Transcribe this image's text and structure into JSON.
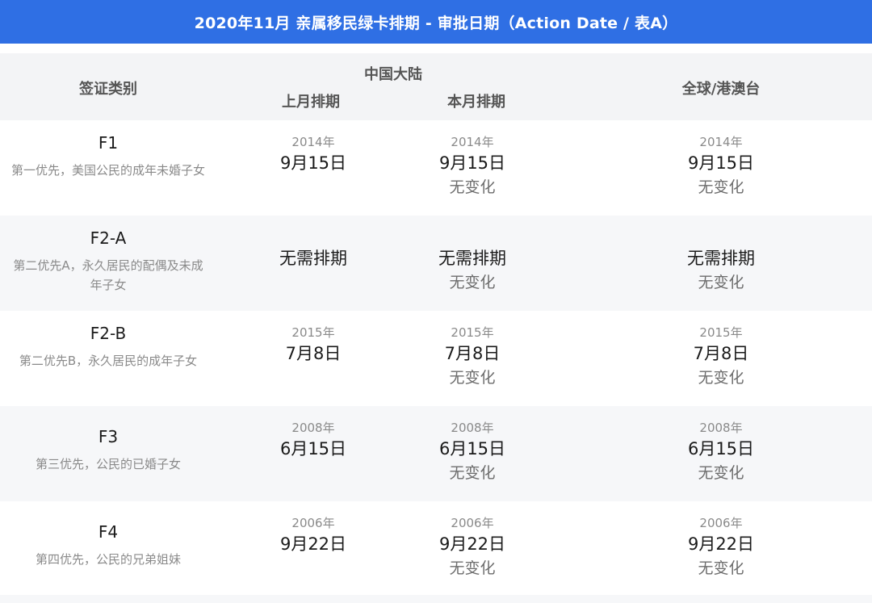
{
  "title": "2020年11月 亲属移民绿卡排期 - 审批日期（Action Date / 表A）",
  "header": {
    "category": "签证类别",
    "china": "中国大陆",
    "last_month": "上月排期",
    "this_month": "本月排期",
    "global": "全球/港澳台"
  },
  "rows": [
    {
      "code": "F1",
      "desc": "第一优先，美国公民的成年未婚子女",
      "last": {
        "year": "2014年",
        "date": "9月15日"
      },
      "this": {
        "year": "2014年",
        "date": "9月15日",
        "status": "无变化"
      },
      "global": {
        "year": "2014年",
        "date": "9月15日",
        "status": "无变化"
      }
    },
    {
      "code": "F2-A",
      "desc": "第二优先A，永久居民的配偶及未成年子女",
      "last": {
        "year": "",
        "date": "无需排期"
      },
      "this": {
        "year": "",
        "date": "无需排期",
        "status": "无变化"
      },
      "global": {
        "year": "",
        "date": "无需排期",
        "status": "无变化"
      }
    },
    {
      "code": "F2-B",
      "desc": "第二优先B，永久居民的成年子女",
      "last": {
        "year": "2015年",
        "date": "7月8日"
      },
      "this": {
        "year": "2015年",
        "date": "7月8日",
        "status": "无变化"
      },
      "global": {
        "year": "2015年",
        "date": "7月8日",
        "status": "无变化"
      }
    },
    {
      "code": "F3",
      "desc": "第三优先，公民的已婚子女",
      "last": {
        "year": "2008年",
        "date": "6月15日"
      },
      "this": {
        "year": "2008年",
        "date": "6月15日",
        "status": "无变化"
      },
      "global": {
        "year": "2008年",
        "date": "6月15日",
        "status": "无变化"
      }
    },
    {
      "code": "F4",
      "desc": "第四优先，公民的兄弟姐妹",
      "last": {
        "year": "2006年",
        "date": "9月22日"
      },
      "this": {
        "year": "2006年",
        "date": "9月22日",
        "status": "无变化"
      },
      "global": {
        "year": "2006年",
        "date": "9月22日",
        "status": "无变化"
      }
    }
  ]
}
